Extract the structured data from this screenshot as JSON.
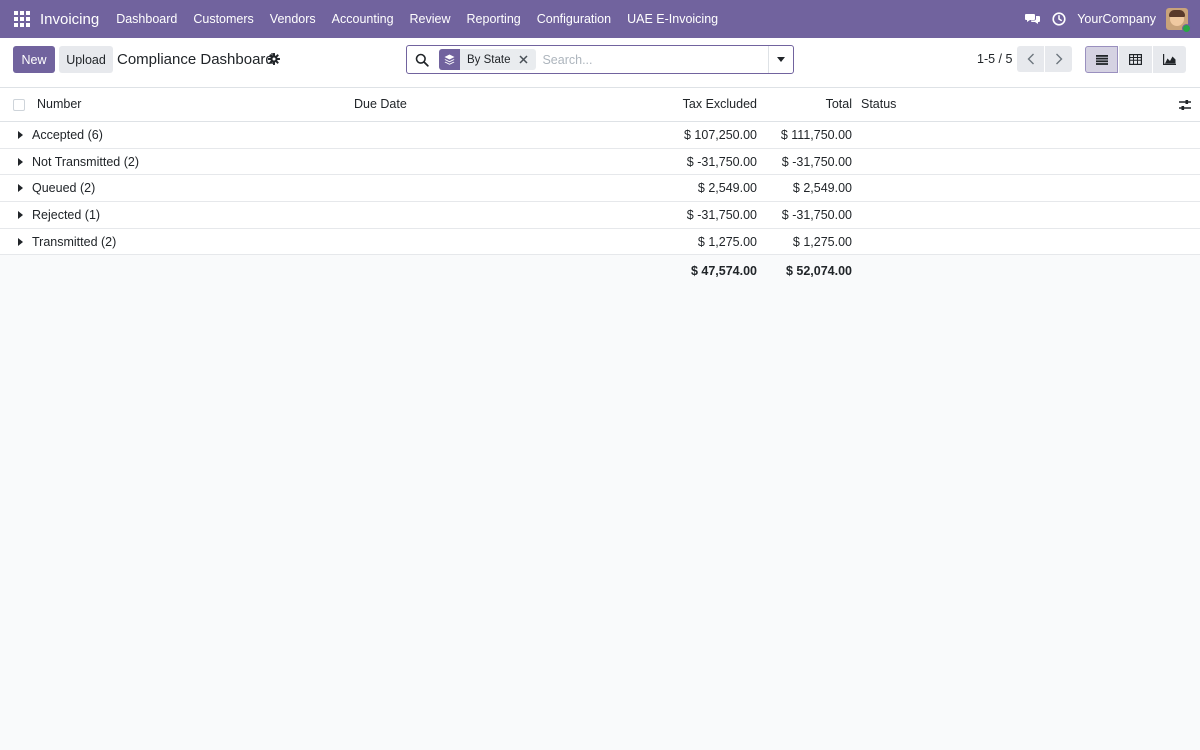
{
  "navbar": {
    "brand": "Invoicing",
    "menu": [
      "Dashboard",
      "Customers",
      "Vendors",
      "Accounting",
      "Review",
      "Reporting",
      "Configuration",
      "UAE E-Invoicing"
    ],
    "company": "YourCompany",
    "icons": [
      "apps-icon",
      "chat-icon",
      "clock-icon",
      "user-avatar"
    ]
  },
  "control": {
    "new_label": "New",
    "upload_label": "Upload",
    "title": "Compliance Dashboard",
    "search": {
      "facet_label": "By State",
      "placeholder": "Search..."
    },
    "pager": "1-5 / 5"
  },
  "table": {
    "columns": {
      "number": "Number",
      "due_date": "Due Date",
      "tax_excluded": "Tax Excluded",
      "total": "Total",
      "status": "Status"
    },
    "groups": [
      {
        "label": "Accepted (6)",
        "tax_excluded": "$ 107,250.00",
        "total": "$ 111,750.00"
      },
      {
        "label": "Not Transmitted (2)",
        "tax_excluded": "$ -31,750.00",
        "total": "$ -31,750.00"
      },
      {
        "label": "Queued (2)",
        "tax_excluded": "$ 2,549.00",
        "total": "$ 2,549.00"
      },
      {
        "label": "Rejected (1)",
        "tax_excluded": "$ -31,750.00",
        "total": "$ -31,750.00"
      },
      {
        "label": "Transmitted (2)",
        "tax_excluded": "$ 1,275.00",
        "total": "$ 1,275.00"
      }
    ],
    "totals": {
      "tax_excluded": "$ 47,574.00",
      "total": "$ 52,074.00"
    }
  },
  "colors": {
    "brand": "#71639e",
    "background": "#f9fafb"
  }
}
